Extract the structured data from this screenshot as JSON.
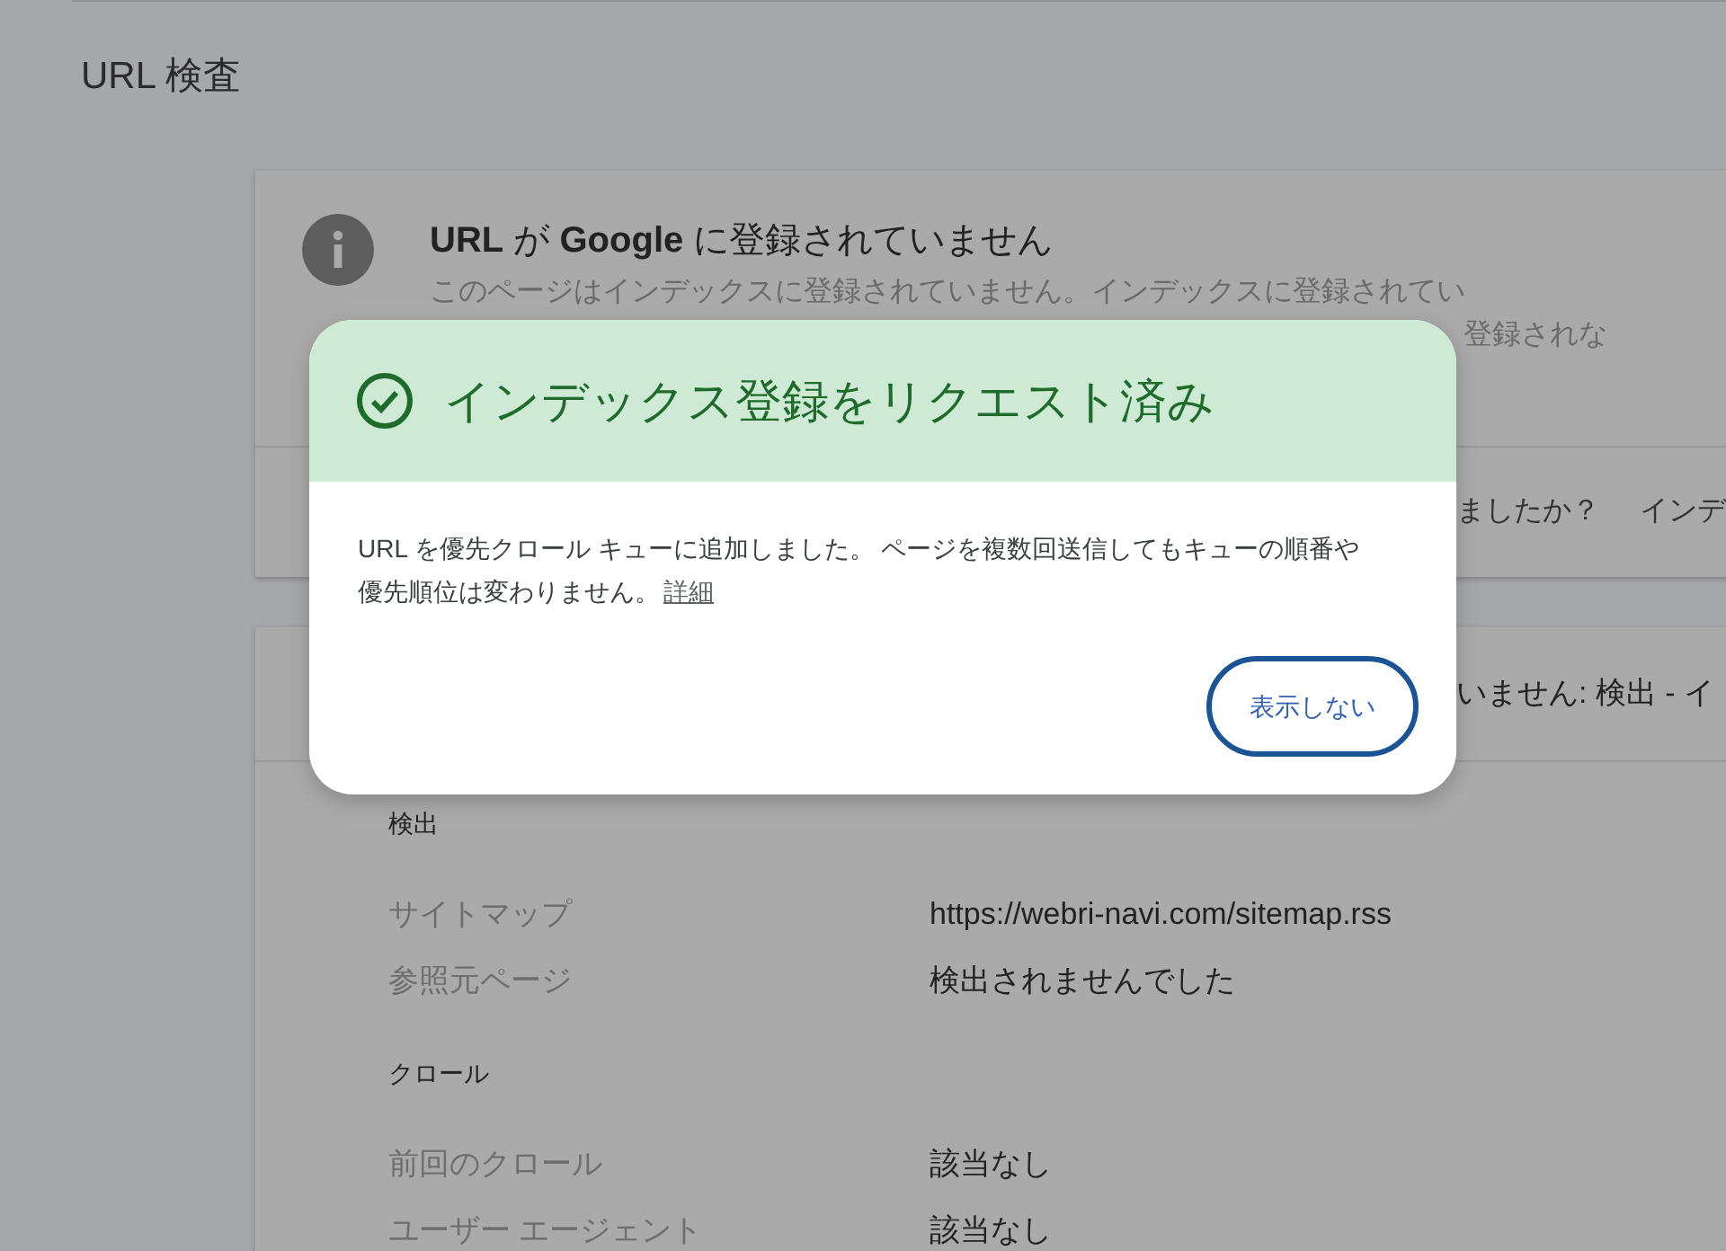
{
  "page_title": "URL 検査",
  "status_card": {
    "title": "**URL** が **Google** に登録されていません",
    "description_lines": [
      "このページはインデックスに登録されていません。インデックスに登録されてい",
      "登録されな"
    ],
    "footer_texts": [
      "ましたか？",
      "インデ"
    ]
  },
  "details_card": {
    "header": "いません: 検出 - イ",
    "sections": [
      {
        "title": "検出",
        "rows": [
          {
            "label": "サイトマップ",
            "value": "https://webri-navi.com/sitemap.rss"
          },
          {
            "label": "参照元ページ",
            "value": "検出されませんでした"
          }
        ]
      },
      {
        "title": "クロール",
        "rows": [
          {
            "label": "前回のクロール",
            "value": "該当なし"
          },
          {
            "label": "ユーザー エージェント",
            "value": "該当なし"
          }
        ]
      }
    ]
  },
  "dialog": {
    "title": "インデックス登録をリクエスト済み",
    "message": "URL を優先クロール キューに追加しました。 ページを複数回送信してもキューの順番や優先順位は変わりません。",
    "link": "詳細",
    "button": "表示しない"
  }
}
